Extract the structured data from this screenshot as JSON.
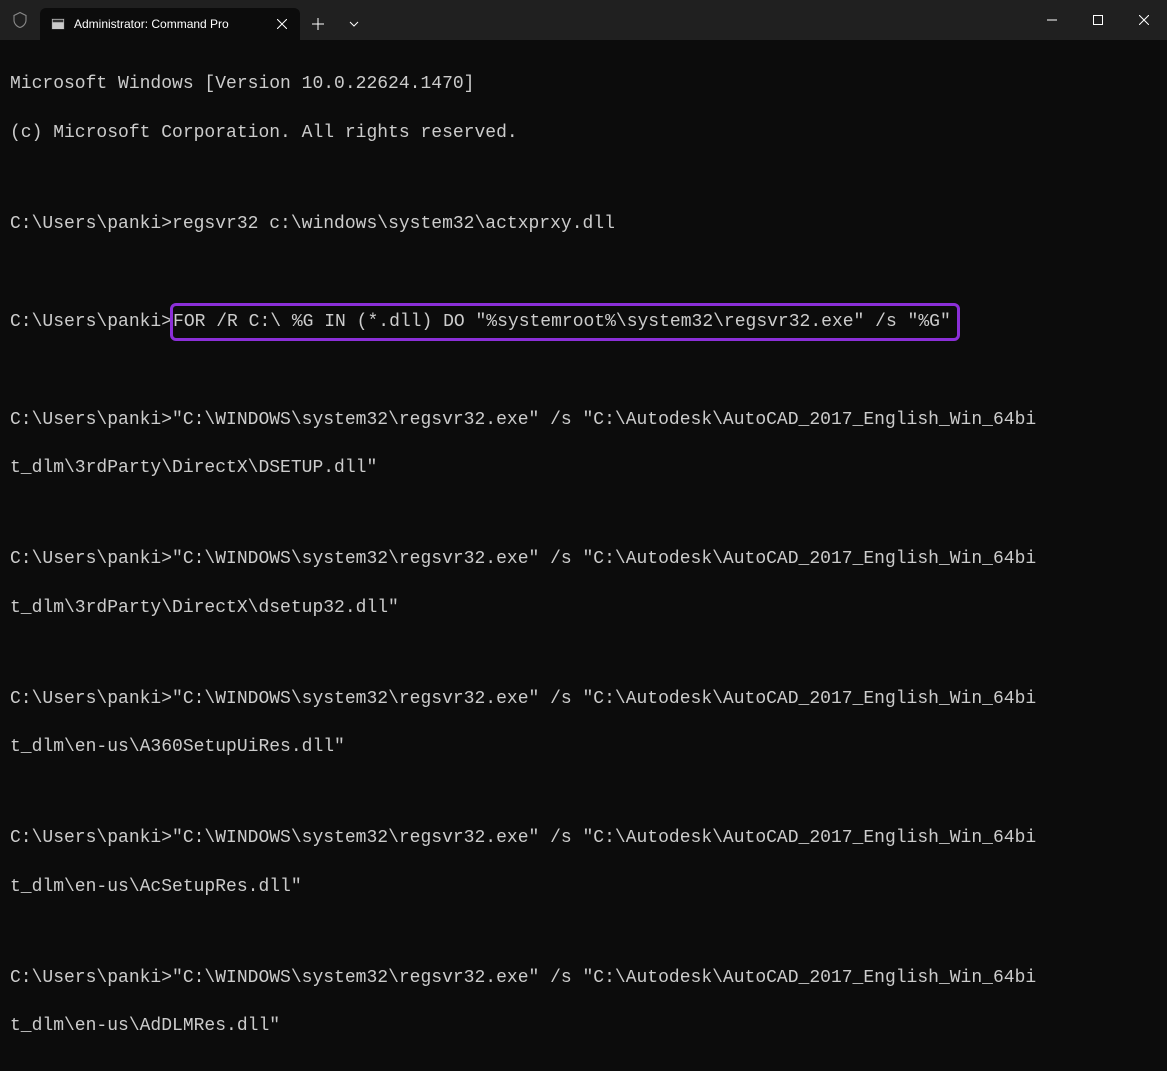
{
  "titlebar": {
    "tab_title": "Administrator: Command Pro"
  },
  "terminal": {
    "line1": "Microsoft Windows [Version 10.0.22624.1470]",
    "line2": "(c) Microsoft Corporation. All rights reserved.",
    "prompt": "C:\\Users\\panki>",
    "cmd1": "regsvr32 c:\\windows\\system32\\actxprxy.dll",
    "cmd2": "FOR /R C:\\ %G IN (*.dll) DO \"%systemroot%\\system32\\regsvr32.exe\" /s \"%G\"",
    "out1_a": "\"C:\\WINDOWS\\system32\\regsvr32.exe\" /s \"C:\\Autodesk\\AutoCAD_2017_English_Win_64bi",
    "out1_b": "t_dlm\\3rdParty\\DirectX\\DSETUP.dll\"",
    "out2_a": "\"C:\\WINDOWS\\system32\\regsvr32.exe\" /s \"C:\\Autodesk\\AutoCAD_2017_English_Win_64bi",
    "out2_b": "t_dlm\\3rdParty\\DirectX\\dsetup32.dll\"",
    "out3_a": "\"C:\\WINDOWS\\system32\\regsvr32.exe\" /s \"C:\\Autodesk\\AutoCAD_2017_English_Win_64bi",
    "out3_b": "t_dlm\\en-us\\A360SetupUiRes.dll\"",
    "out4_a": "\"C:\\WINDOWS\\system32\\regsvr32.exe\" /s \"C:\\Autodesk\\AutoCAD_2017_English_Win_64bi",
    "out4_b": "t_dlm\\en-us\\AcSetupRes.dll\"",
    "out5_a": "\"C:\\WINDOWS\\system32\\regsvr32.exe\" /s \"C:\\Autodesk\\AutoCAD_2017_English_Win_64bi",
    "out5_b": "t_dlm\\en-us\\AdDLMRes.dll\""
  },
  "colors": {
    "highlight": "#8b2fd8",
    "bg": "#0c0c0c",
    "titlebar_bg": "#202020",
    "text": "#cccccc"
  }
}
